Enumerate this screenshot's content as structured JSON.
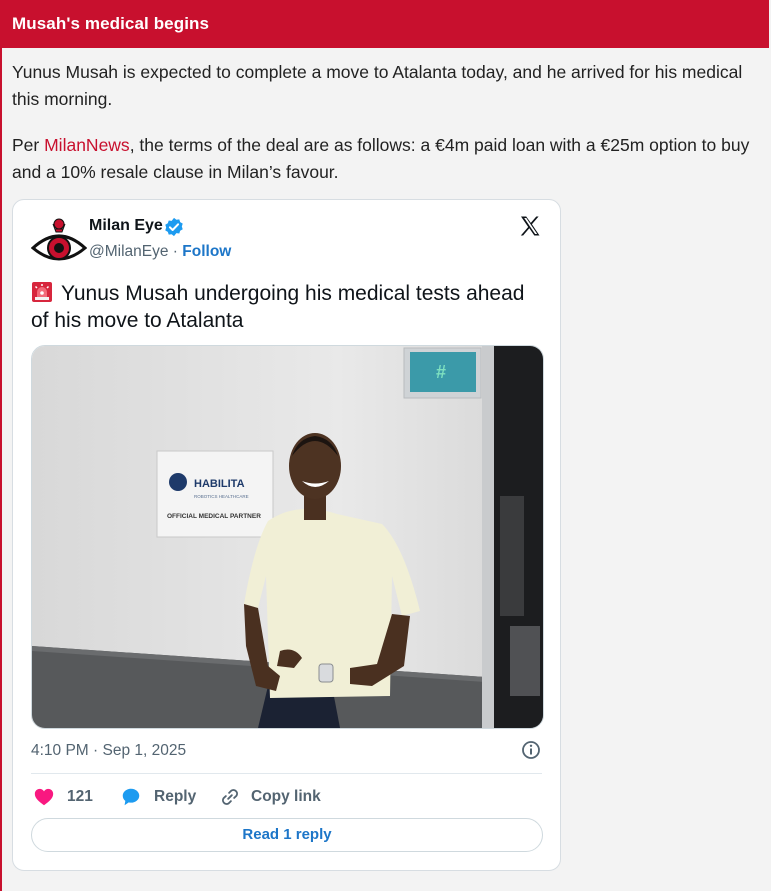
{
  "header": {
    "title": "Musah's medical begins"
  },
  "article": {
    "para1": "Yunus Musah is expected to complete a move to Atalanta today, and he arrived for his medical this morning.",
    "para2_prefix": "Per ",
    "para2_link": "MilanNews",
    "para2_suffix": ", the terms of the deal are as follows: a €4m paid loan with a €25m option to buy and a 10% resale clause in Milan’s favour."
  },
  "tweet": {
    "author_name": "Milan Eye",
    "handle": "@MilanEye",
    "separator": " · ",
    "follow_label": "Follow",
    "text": "Yunus Musah undergoing his medical tests ahead of his move to Atalanta",
    "photo": {
      "sign_brand": "HABILITA",
      "sign_sub": "ROBOTICS HEALTHCARE",
      "sign_caption": "OFFICIAL MEDICAL PARTNER"
    },
    "timestamp": "4:10 PM · Sep 1, 2025",
    "like_count": "121",
    "reply_label": "Reply",
    "copy_label": "Copy link",
    "read_reply_label": "Read 1 reply"
  },
  "colors": {
    "brand_red": "#c8102e",
    "link_blue": "#1d76c8",
    "verified_blue": "#1d9bf0",
    "like_pink": "#f91880"
  },
  "icons": [
    "siren-icon",
    "verified-badge-icon",
    "x-logo-icon",
    "info-icon",
    "heart-icon",
    "reply-bubble-icon",
    "link-icon"
  ]
}
